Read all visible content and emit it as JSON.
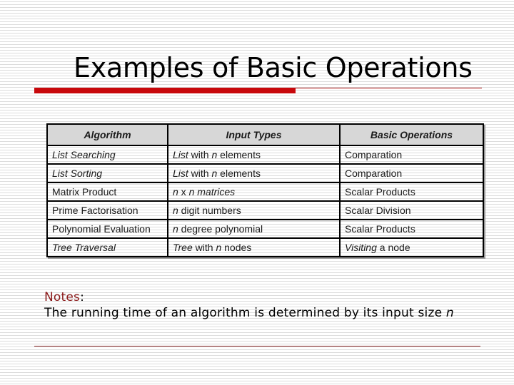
{
  "slide": {
    "title": "Examples of Basic Operations"
  },
  "table": {
    "headers": [
      "Algorithm",
      "Input Types",
      "Basic Operations"
    ],
    "rows": [
      {
        "algorithm": "List Searching",
        "algorithm_italic": true,
        "input": [
          {
            "t": "List",
            "i": true
          },
          {
            "t": " with ",
            "i": false
          },
          {
            "t": "n",
            "i": true
          },
          {
            "t": " elements",
            "i": false
          }
        ],
        "operation": [
          {
            "t": "Comparation",
            "i": false
          }
        ]
      },
      {
        "algorithm": "List Sorting",
        "algorithm_italic": true,
        "input": [
          {
            "t": "List",
            "i": true
          },
          {
            "t": " with ",
            "i": false
          },
          {
            "t": "n",
            "i": true
          },
          {
            "t": " elements",
            "i": false
          }
        ],
        "operation": [
          {
            "t": "Comparation",
            "i": false
          }
        ]
      },
      {
        "algorithm": "Matrix Product",
        "algorithm_italic": false,
        "input": [
          {
            "t": "n",
            "i": true
          },
          {
            "t": " x ",
            "i": false
          },
          {
            "t": "n matrices",
            "i": true
          }
        ],
        "operation": [
          {
            "t": "Scalar Products",
            "i": false
          }
        ]
      },
      {
        "algorithm": "Prime Factorisation",
        "algorithm_italic": false,
        "input": [
          {
            "t": "n",
            "i": true
          },
          {
            "t": " digit numbers",
            "i": false
          }
        ],
        "operation": [
          {
            "t": "Scalar Division",
            "i": false
          }
        ]
      },
      {
        "algorithm": "Polynomial Evaluation",
        "algorithm_italic": false,
        "input": [
          {
            "t": "n",
            "i": true
          },
          {
            "t": " degree polynomial",
            "i": false
          }
        ],
        "operation": [
          {
            "t": "Scalar Products",
            "i": false
          }
        ]
      },
      {
        "algorithm": "Tree Traversal",
        "algorithm_italic": true,
        "input": [
          {
            "t": "Tree",
            "i": true
          },
          {
            "t": " with ",
            "i": false
          },
          {
            "t": "n",
            "i": true
          },
          {
            "t": " nodes",
            "i": false
          }
        ],
        "operation": [
          {
            "t": "Visiting",
            "i": true
          },
          {
            "t": " a node",
            "i": false
          }
        ]
      }
    ]
  },
  "notes": {
    "label": "Notes",
    "colon": ":",
    "text": "The running time of an algorithm is determined by its input size ",
    "variable": "n"
  },
  "colors": {
    "accent_red": "#c8080c",
    "notes_label": "#8b1a1a",
    "header_fill": "#d7d7d7"
  }
}
